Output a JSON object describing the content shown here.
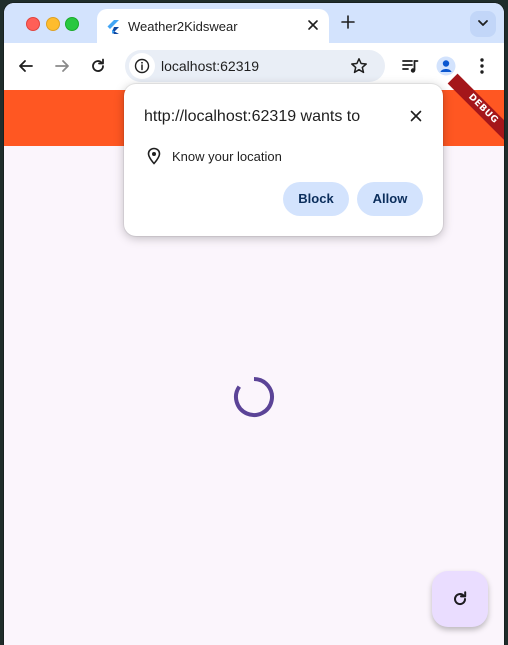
{
  "tab": {
    "title": "Weather2Kidswear"
  },
  "address_bar": {
    "url": "localhost:62319"
  },
  "app": {
    "debug_banner": "DEBUG"
  },
  "permission_prompt": {
    "title": "http://localhost:62319 wants to",
    "permission": "Know your location",
    "block_label": "Block",
    "allow_label": "Allow"
  },
  "colors": {
    "app_bar": "#ff5722",
    "spinner": "#5b4397",
    "fab_bg": "#eaddff",
    "prompt_button_bg": "#d3e3fd"
  },
  "icons": {
    "tab_favicon": "flutter-icon",
    "fab": "refresh-icon"
  }
}
